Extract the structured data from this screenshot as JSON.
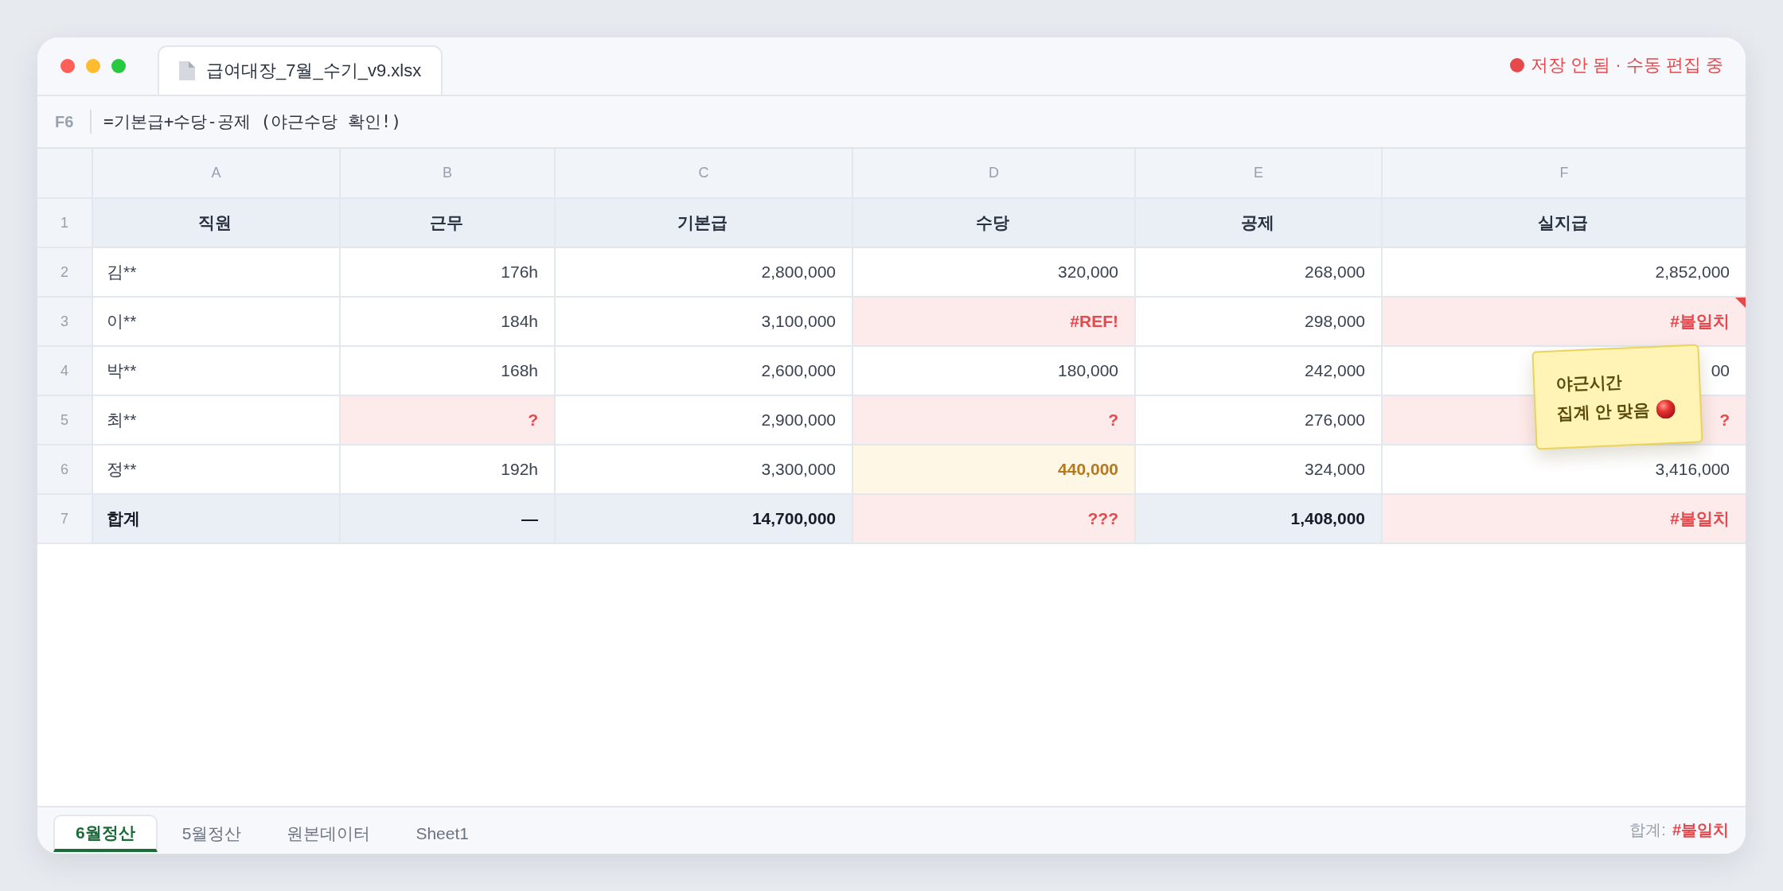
{
  "title_bar": {
    "file_name": "급여대장_7월_수기_v9.xlsx",
    "saved": false,
    "save_status": "저장 안 됨 · 수동 편집 중"
  },
  "formula_bar": {
    "cell_ref": "F6",
    "formula": "=기본급+수당-공제 (야근수당 확인!)"
  },
  "sheet": {
    "columns": [
      "A",
      "B",
      "C",
      "D",
      "E",
      "F"
    ],
    "rows": [
      {
        "number": "1",
        "kind": "header",
        "cells": [
          {
            "text": "직원",
            "kind": "plain",
            "comment": false
          },
          {
            "text": "근무",
            "kind": "plain",
            "comment": false
          },
          {
            "text": "기본급",
            "kind": "plain",
            "comment": false
          },
          {
            "text": "수당",
            "kind": "plain",
            "comment": false
          },
          {
            "text": "공제",
            "kind": "plain",
            "comment": false
          },
          {
            "text": "실지급",
            "kind": "plain",
            "comment": false
          }
        ]
      },
      {
        "number": "2",
        "kind": "data",
        "cells": [
          {
            "text": "김**",
            "kind": "plain",
            "comment": false
          },
          {
            "text": "176h",
            "kind": "plain",
            "comment": false
          },
          {
            "text": "2,800,000",
            "kind": "plain",
            "comment": false
          },
          {
            "text": "320,000",
            "kind": "plain",
            "comment": false
          },
          {
            "text": "268,000",
            "kind": "plain",
            "comment": false
          },
          {
            "text": "2,852,000",
            "kind": "plain",
            "comment": false
          }
        ]
      },
      {
        "number": "3",
        "kind": "data",
        "cells": [
          {
            "text": "이**",
            "kind": "plain",
            "comment": false
          },
          {
            "text": "184h",
            "kind": "plain",
            "comment": false
          },
          {
            "text": "3,100,000",
            "kind": "plain",
            "comment": false
          },
          {
            "text": "#REF!",
            "kind": "error",
            "comment": false
          },
          {
            "text": "298,000",
            "kind": "plain",
            "comment": false
          },
          {
            "text": "#불일치",
            "kind": "error",
            "comment": true
          }
        ]
      },
      {
        "number": "4",
        "kind": "data",
        "cells": [
          {
            "text": "박**",
            "kind": "plain",
            "comment": false
          },
          {
            "text": "168h",
            "kind": "plain",
            "comment": false
          },
          {
            "text": "2,600,000",
            "kind": "plain",
            "comment": false
          },
          {
            "text": "180,000",
            "kind": "plain",
            "comment": false
          },
          {
            "text": "242,000",
            "kind": "plain",
            "comment": false
          },
          {
            "text": "00",
            "kind": "plain",
            "comment": false
          }
        ]
      },
      {
        "number": "5",
        "kind": "data",
        "cells": [
          {
            "text": "최**",
            "kind": "plain",
            "comment": false
          },
          {
            "text": "?",
            "kind": "error",
            "comment": false
          },
          {
            "text": "2,900,000",
            "kind": "plain",
            "comment": false
          },
          {
            "text": "?",
            "kind": "error",
            "comment": false
          },
          {
            "text": "276,000",
            "kind": "plain",
            "comment": false
          },
          {
            "text": "?",
            "kind": "error",
            "comment": false
          }
        ]
      },
      {
        "number": "6",
        "kind": "data",
        "cells": [
          {
            "text": "정**",
            "kind": "plain",
            "comment": false
          },
          {
            "text": "192h",
            "kind": "plain",
            "comment": false
          },
          {
            "text": "3,300,000",
            "kind": "plain",
            "comment": false
          },
          {
            "text": "440,000",
            "kind": "warning",
            "comment": false
          },
          {
            "text": "324,000",
            "kind": "plain",
            "comment": false
          },
          {
            "text": "3,416,000",
            "kind": "plain",
            "comment": false
          }
        ]
      },
      {
        "number": "7",
        "kind": "total",
        "cells": [
          {
            "text": "합계",
            "kind": "plain",
            "comment": false
          },
          {
            "text": "—",
            "kind": "plain",
            "comment": false
          },
          {
            "text": "14,700,000",
            "kind": "plain",
            "comment": false
          },
          {
            "text": "???",
            "kind": "error",
            "comment": false
          },
          {
            "text": "1,408,000",
            "kind": "plain",
            "comment": false
          },
          {
            "text": "#불일치",
            "kind": "error",
            "comment": false
          }
        ]
      }
    ]
  },
  "note": {
    "lines": [
      "야근시간",
      "집계 안 맞음"
    ]
  },
  "sheet_tabs": [
    {
      "label": "6월정산",
      "selected": true
    },
    {
      "label": "5월정산",
      "selected": false
    },
    {
      "label": "원본데이터",
      "selected": false
    },
    {
      "label": "Sheet1",
      "selected": false
    }
  ],
  "status_bar": {
    "label": "합계:",
    "value": "#불일치"
  }
}
